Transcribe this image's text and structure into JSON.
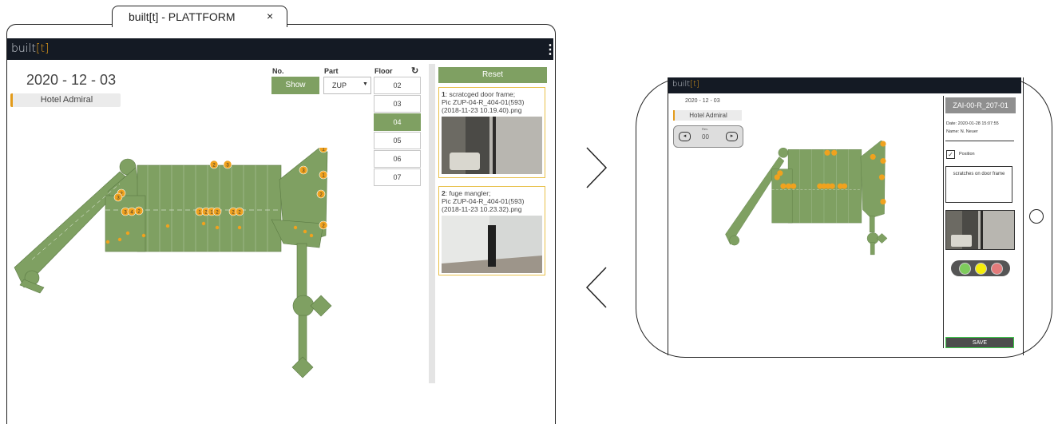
{
  "browser": {
    "tab_title": "built[t] - PLATTFORM",
    "tab_close": "×"
  },
  "app": {
    "brand_prefix": "built",
    "brand_accent": "[t]",
    "brand_colors": {
      "text": "#cfd3da",
      "accent": "#e39b1a",
      "bar": "#141a24"
    },
    "menu_icon": "⋮"
  },
  "desktop": {
    "date": "2020 - 12 - 03",
    "project": "Hotel Admiral",
    "filters": {
      "no_header": "No.",
      "show_label": "Show",
      "part_header": "Part",
      "part_value": "ZUP",
      "floor_header": "Floor",
      "refresh_icon": "refresh-icon",
      "floors": [
        "02",
        "03",
        "04",
        "05",
        "06",
        "07"
      ],
      "active_floor": "04"
    },
    "reset_label": "Reset",
    "defects": [
      {
        "no": "1",
        "text": ": scratcged door frame;",
        "pic": "Pic ZUP-04-R_404-01(593)(2018-11-23 10.19.40).png"
      },
      {
        "no": "2",
        "text": ": fuge mangler;",
        "pic": "Pic ZUP-04-R_404-01(593)(2018-11-23 10.23.32).png"
      }
    ],
    "markers": [
      "2",
      "3",
      "3",
      "4",
      "2",
      "2",
      "3",
      "1",
      "2",
      "1",
      "2",
      "2",
      "2",
      "3",
      "1",
      "1",
      "2",
      "2"
    ]
  },
  "nav": {
    "next_icon": "chevron-right-icon",
    "prev_icon": "chevron-left-icon",
    "next_glyph": "›",
    "prev_glyph": "‹"
  },
  "tablet": {
    "brand_prefix": "built",
    "brand_accent": "[t]",
    "date": "2020 - 12 - 03",
    "project": "Hotel Admiral",
    "stepper": {
      "label": "Rev.",
      "value": "00"
    },
    "room_title": "ZAI-00-R_207-01",
    "meta_date": "Date: 2020-01-28 15:07:55",
    "meta_name": "Name: N. Neuer",
    "position_label": "Position",
    "comment": "scratches on door frame",
    "traffic_colors": [
      "#7ecb5c",
      "#f5ee0a",
      "#e47b7b"
    ],
    "save_label": "SAVE"
  },
  "colors": {
    "green": "#7fa062",
    "marker": "#f0a21e",
    "card_border": "#e8c04a"
  }
}
